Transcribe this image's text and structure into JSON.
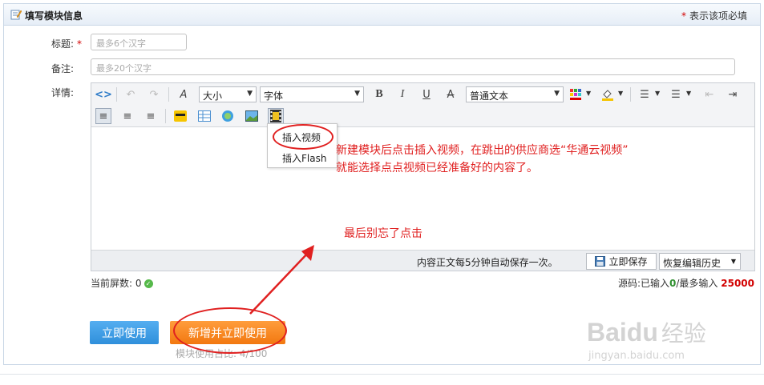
{
  "header": {
    "title": "填写模块信息",
    "required_star": "*",
    "required_note": "表示该项必填"
  },
  "form": {
    "title_label": "标题:",
    "title_star": "*",
    "title_placeholder": "最多6个汉字",
    "note_label": "备注:",
    "note_placeholder": "最多20个汉字",
    "detail_label": "详情:"
  },
  "toolbar": {
    "size_select": "大小",
    "font_select": "字体",
    "format_select": "普通文本",
    "bold": "B",
    "italic": "I",
    "underline": "U",
    "strike": "A"
  },
  "dropdown": {
    "items": [
      "插入视频",
      "插入Flash"
    ]
  },
  "annotations": {
    "line1": "新建模块后点击插入视频，在跳出的供应商选“华通云视频”",
    "line2": "就能选择点点视频已经准备好的内容了。",
    "bottom": "最后别忘了点击"
  },
  "status": {
    "autosave": "内容正文每5分钟自动保存一次。",
    "save_button": "立即保存",
    "restore_button": "恢复编辑历史"
  },
  "screens": {
    "label": "当前屏数:",
    "value": "0"
  },
  "source_count": {
    "prefix": "源码:已输入",
    "entered": "0",
    "middle": "/最多输入",
    "max": "25000"
  },
  "buttons": {
    "use": "立即使用",
    "add_use": "新增并立即使用"
  },
  "usage": "模块使用占比: 4/100",
  "watermark": {
    "brand": "Bai",
    "brand2": "du",
    "cn": "经验",
    "url": "jingyan.baidu.com"
  },
  "colors": {
    "required": "#d20000",
    "annotation": "#e02020",
    "use_button": "#2f8fdb",
    "add_button": "#f27810"
  }
}
